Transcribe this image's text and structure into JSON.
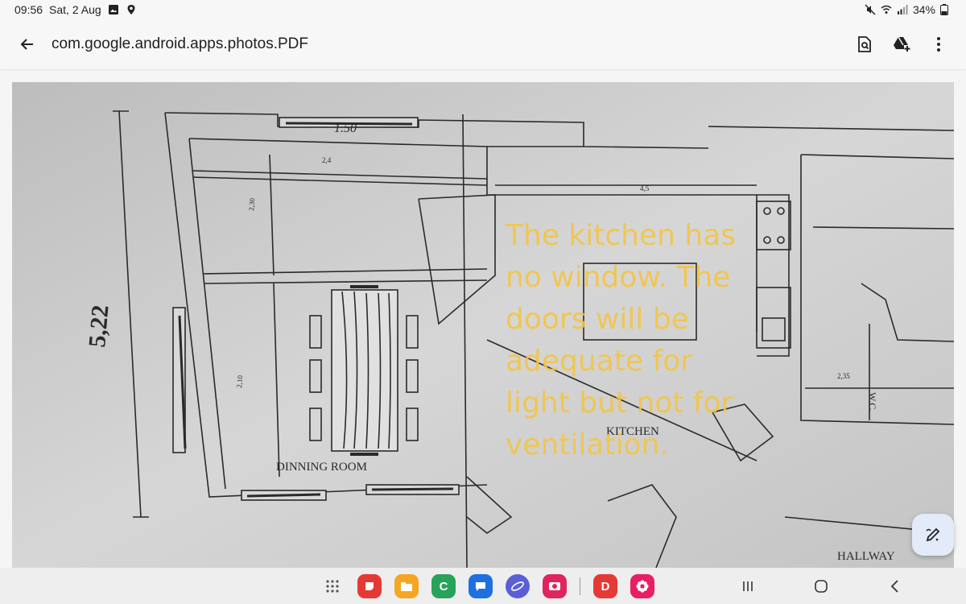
{
  "status_bar": {
    "time": "09:56",
    "date": "Sat, 2 Aug",
    "battery": "34%",
    "icons": [
      "gallery-icon",
      "location-icon",
      "mute-icon",
      "wifi-icon",
      "signal-icon",
      "battery-icon"
    ]
  },
  "app_bar": {
    "title": "com.google.android.apps.photos.PDF",
    "actions": [
      "find-in-page-icon",
      "drive-add-icon",
      "more-options-icon"
    ]
  },
  "document": {
    "plan_labels": {
      "dimension_main": "5,22",
      "dinning_room": "DINNING ROOM",
      "kitchen": "KITCHEN",
      "hallway": "HALLWAY",
      "wc": "W.C.",
      "top_dim": "1.50",
      "small_1": "2,4",
      "small_2": "4,5",
      "small_3": "2,10",
      "small_4": "2,35",
      "small_5": "2,30"
    },
    "annotation": "The kitchen has no window. The doors will be adequate for light but not for ventilation.",
    "annotation_color": "#f4c542"
  },
  "taskbar": {
    "apps": [
      {
        "name": "app-drawer-icon"
      },
      {
        "name": "notes-app-icon",
        "color": "#e53935"
      },
      {
        "name": "files-app-icon",
        "color": "#f5a623"
      },
      {
        "name": "phone-app-icon",
        "color": "#27a35a",
        "glyph": "C"
      },
      {
        "name": "messages-app-icon",
        "color": "#1e6fe0"
      },
      {
        "name": "internet-app-icon",
        "color": "#5b5fd6"
      },
      {
        "name": "screen-recorder-app-icon",
        "color": "#e0245e"
      },
      {
        "name": "d-app-icon",
        "color": "#e53935",
        "glyph": "D"
      },
      {
        "name": "flower-app-icon",
        "color": "#e91e63"
      }
    ]
  }
}
